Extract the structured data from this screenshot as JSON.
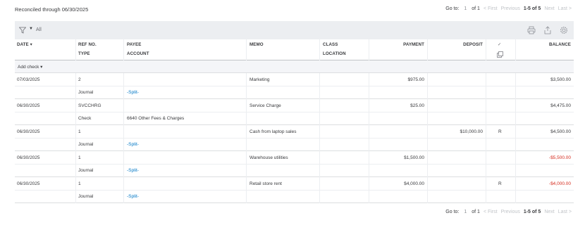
{
  "top": {
    "reconciled_text": "Reconciled through 06/30/2025",
    "pager": {
      "goto_label": "Go to:",
      "page_value": "1",
      "of_text": "of 1",
      "first": "< First",
      "previous": "Previous",
      "range": "1-5 of 5",
      "next": "Next",
      "last": "Last >"
    }
  },
  "toolbar": {
    "filter_label": "All",
    "filter_icon": "filter-icon",
    "icons": [
      "print-icon",
      "export-icon",
      "settings-gear-icon"
    ]
  },
  "columns": {
    "date": "DATE",
    "refno": "REF NO.",
    "type": "TYPE",
    "payee": "PAYEE",
    "account": "ACCOUNT",
    "memo": "MEMO",
    "class": "CLASS",
    "location": "LOCATION",
    "payment": "PAYMENT",
    "deposit": "DEPOSIT",
    "check_mark": "✓",
    "balance": "BALANCE"
  },
  "add_check_label": "Add check",
  "rows": [
    {
      "date": "07/03/2025",
      "refno": "2",
      "type": "Journal",
      "payee": "",
      "account": "-Split-",
      "memo": "Marketing",
      "payment": "$975.00",
      "deposit": "",
      "status": "",
      "balance": "$3,500.00",
      "negative": false
    },
    {
      "date": "06/30/2025",
      "refno": "SVCCHRG",
      "type": "Check",
      "payee": "",
      "account": "6640 Other Fees & Charges",
      "memo": "Service Charge",
      "payment": "$25.00",
      "deposit": "",
      "status": "",
      "balance": "$4,475.00",
      "negative": false
    },
    {
      "date": "06/30/2025",
      "refno": "1",
      "type": "Journal",
      "payee": "",
      "account": "-Split-",
      "memo": "Cash from laptop sales",
      "payment": "",
      "deposit": "$10,000.00",
      "status": "R",
      "balance": "$4,500.00",
      "negative": false
    },
    {
      "date": "06/30/2025",
      "refno": "1",
      "type": "Journal",
      "payee": "",
      "account": "-Split-",
      "memo": "Warehouse utilities",
      "payment": "$1,500.00",
      "deposit": "",
      "status": "",
      "balance": "-$5,500.00",
      "negative": true
    },
    {
      "date": "06/30/2025",
      "refno": "1",
      "type": "Journal",
      "payee": "",
      "account": "-Split-",
      "memo": "Retail store rent",
      "payment": "$4,000.00",
      "deposit": "",
      "status": "R",
      "balance": "-$4,000.00",
      "negative": true
    }
  ],
  "bottom_pager": {
    "goto_label": "Go to:",
    "page_value": "1",
    "of_text": "of 1",
    "first": "< First",
    "previous": "Previous",
    "range": "1-5 of 5",
    "next": "Next",
    "last": "Last >"
  },
  "colors": {
    "link": "#0077c5",
    "negative": "#d52b1e",
    "toolbar_bg": "#eceef1"
  }
}
